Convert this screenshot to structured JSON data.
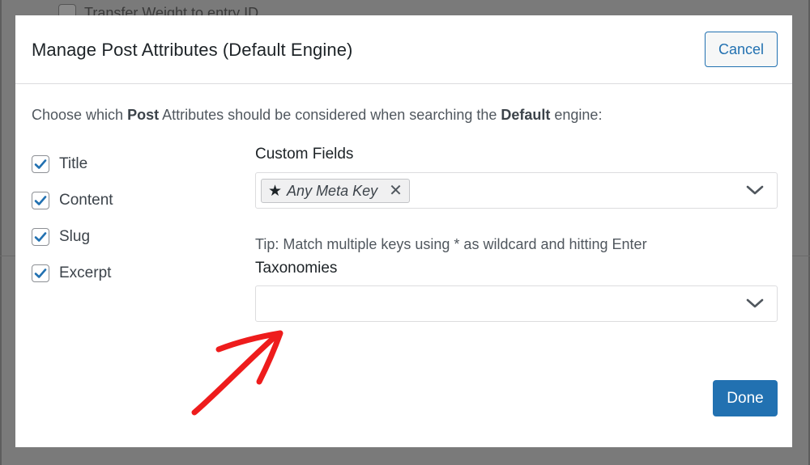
{
  "background": {
    "row_label": "Transfer Weight to entry ID"
  },
  "modal": {
    "title": "Manage Post Attributes (Default Engine)",
    "cancel_label": "Cancel",
    "intro_prefix": "Choose which ",
    "intro_bold_1": "Post",
    "intro_middle": " Attributes should be considered when searching the ",
    "intro_bold_2": "Default",
    "intro_suffix": " engine:",
    "attributes": [
      {
        "label": "Title",
        "checked": true
      },
      {
        "label": "Content",
        "checked": true
      },
      {
        "label": "Slug",
        "checked": true
      },
      {
        "label": "Excerpt",
        "checked": true
      }
    ],
    "custom_fields": {
      "label": "Custom Fields",
      "chip_label": "Any Meta Key",
      "chip_icon": "star-icon",
      "tip": "Tip: Match multiple keys using * as wildcard and hitting Enter"
    },
    "taxonomies": {
      "label": "Taxonomies",
      "value": ""
    },
    "done_label": "Done"
  },
  "colors": {
    "accent": "#2271b1",
    "annotation_arrow": "#ee1c1c"
  }
}
